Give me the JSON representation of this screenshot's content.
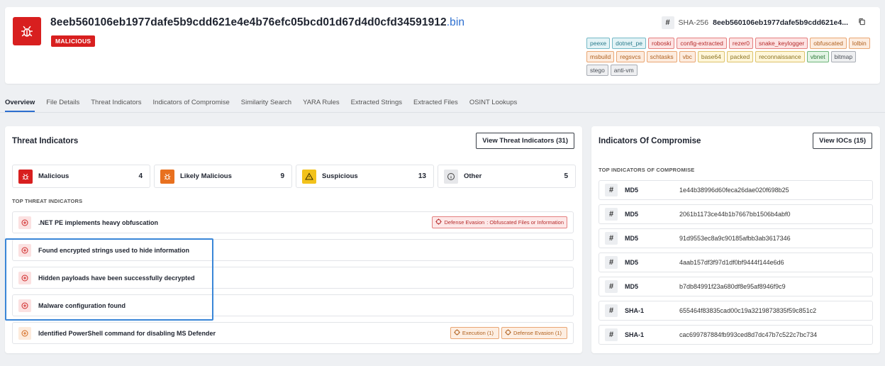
{
  "header": {
    "filename": "8eeb560106eb1977dafe5b9cdd621e4e4b76efc05bcd01d67d4d0cfd34591912",
    "extension": ".bin",
    "verdict": "MALICIOUS",
    "hash_symbol": "#",
    "hash_type": "SHA-256",
    "hash_value": "8eeb560106eb1977dafe5b9cdd621e4...",
    "tags": [
      {
        "label": "peexe",
        "color": "teal"
      },
      {
        "label": "dotnet_pe",
        "color": "teal"
      },
      {
        "label": "roboski",
        "color": "red"
      },
      {
        "label": "config-extracted",
        "color": "red"
      },
      {
        "label": "rezer0",
        "color": "red"
      },
      {
        "label": "snake_keylogger",
        "color": "red"
      },
      {
        "label": "obfuscated",
        "color": "orange"
      },
      {
        "label": "lolbin",
        "color": "orange"
      },
      {
        "label": "msbuild",
        "color": "orange"
      },
      {
        "label": "regsvcs",
        "color": "orange"
      },
      {
        "label": "schtasks",
        "color": "orange"
      },
      {
        "label": "vbc",
        "color": "orange"
      },
      {
        "label": "base64",
        "color": "yellow"
      },
      {
        "label": "packed",
        "color": "yellow"
      },
      {
        "label": "reconnaissance",
        "color": "yellow"
      },
      {
        "label": "vbnet",
        "color": "green"
      },
      {
        "label": "bitmap",
        "color": "gray"
      },
      {
        "label": "stego",
        "color": "gray"
      },
      {
        "label": "anti-vm",
        "color": "gray"
      }
    ]
  },
  "tabs": [
    "Overview",
    "File Details",
    "Threat Indicators",
    "Indicators of Compromise",
    "Similarity Search",
    "YARA Rules",
    "Extracted Strings",
    "Extracted Files",
    "OSINT Lookups"
  ],
  "active_tab": "Overview",
  "threat": {
    "title": "Threat Indicators",
    "view_button": "View Threat Indicators (31)",
    "summary": [
      {
        "label": "Malicious",
        "count": "4",
        "color": "#d81f1f"
      },
      {
        "label": "Likely Malicious",
        "count": "9",
        "color": "#e8701f"
      },
      {
        "label": "Suspicious",
        "count": "13",
        "color": "#f2c21b"
      },
      {
        "label": "Other",
        "count": "5",
        "color": "#e6e7ea"
      }
    ],
    "section_label": "TOP THREAT INDICATORS",
    "indicators": [
      {
        "text": ".NET PE implements heavy obfuscation",
        "color": "#fbe1e1",
        "mitre": [
          {
            "label": "Defense Evasion",
            "detail": ": Obfuscated Files or Information",
            "color": "red"
          }
        ]
      },
      {
        "text": "Found encrypted strings used to hide information",
        "color": "#fbe1e1",
        "mitre": []
      },
      {
        "text": "Hidden payloads have been successfully decrypted",
        "color": "#fbe1e1",
        "mitre": []
      },
      {
        "text": "Malware configuration found",
        "color": "#fbe1e1",
        "mitre": []
      },
      {
        "text": "Identified PowerShell command for disabling MS Defender",
        "color": "#fdebdc",
        "mitre": [
          {
            "label": "Execution (1)",
            "detail": "",
            "color": "orange"
          },
          {
            "label": "Defense Evasion (1)",
            "detail": "",
            "color": "orange"
          }
        ]
      }
    ]
  },
  "ioc": {
    "title": "Indicators Of Compromise",
    "view_button": "View IOCs (15)",
    "section_label": "TOP INDICATORS OF COMPROMISE",
    "hash_symbol": "#",
    "items": [
      {
        "type": "MD5",
        "value": "1e44b38996d60feca26dae020f698b25"
      },
      {
        "type": "MD5",
        "value": "2061b1173ce44b1b7667bb1506b4abf0"
      },
      {
        "type": "MD5",
        "value": "91d9553ec8a9c90185afbb3ab3617346"
      },
      {
        "type": "MD5",
        "value": "4aab157df3f97d1df0bf9444f144e6d6"
      },
      {
        "type": "MD5",
        "value": "b7db84991f23a680df8e95af8946f9c9"
      },
      {
        "type": "SHA-1",
        "value": "655464f83835cad00c19a3219873835f59c851c2"
      },
      {
        "type": "SHA-1",
        "value": "cac699787884fb993ced8d7dc47b7c522c7bc734"
      }
    ]
  }
}
